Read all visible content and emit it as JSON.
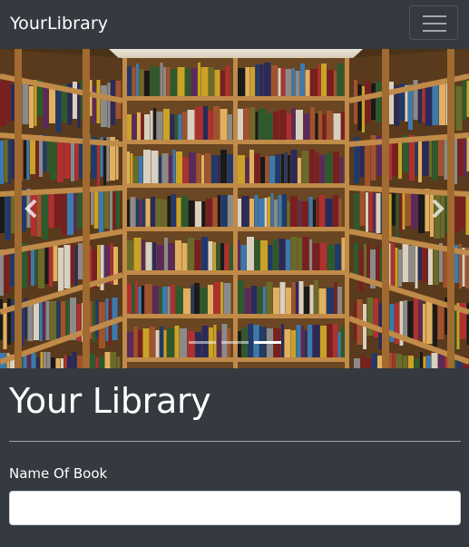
{
  "navbar": {
    "brand": "YourLibrary",
    "toggle_icon": "hamburger-icon"
  },
  "carousel": {
    "slide_count": 3,
    "active_index": 2,
    "prev_icon": "chevron-left-icon",
    "next_icon": "chevron-right-icon"
  },
  "main": {
    "title": "Your Library",
    "form": {
      "book_name_label": "Name Of Book",
      "book_name_value": "",
      "book_name_placeholder": ""
    }
  },
  "colors": {
    "background": "#343a40",
    "text": "#ffffff",
    "input_background": "#ffffff"
  }
}
